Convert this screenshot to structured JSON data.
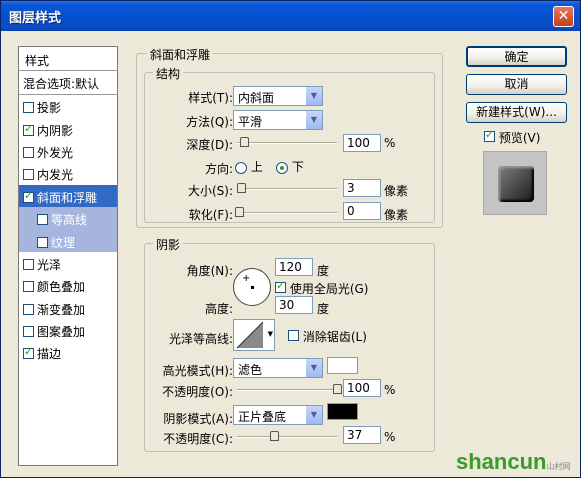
{
  "window": {
    "title": "图层样式"
  },
  "sidebar": {
    "header": "样式",
    "blend": "混合选项:默认",
    "items": [
      {
        "label": "投影",
        "checked": false
      },
      {
        "label": "内阴影",
        "checked": true
      },
      {
        "label": "外发光",
        "checked": false
      },
      {
        "label": "内发光",
        "checked": false
      },
      {
        "label": "斜面和浮雕",
        "checked": true
      },
      {
        "label": "等高线",
        "checked": false
      },
      {
        "label": "纹理",
        "checked": false
      },
      {
        "label": "光泽",
        "checked": false
      },
      {
        "label": "颜色叠加",
        "checked": false
      },
      {
        "label": "渐变叠加",
        "checked": false
      },
      {
        "label": "图案叠加",
        "checked": false
      },
      {
        "label": "描边",
        "checked": true
      }
    ]
  },
  "bevel": {
    "section": "斜面和浮雕",
    "structure": "结构",
    "style_label": "样式(T):",
    "style_value": "内斜面",
    "method_label": "方法(Q):",
    "method_value": "平滑",
    "depth_label": "深度(D):",
    "depth_value": "100",
    "depth_unit": "%",
    "direction_label": "方向:",
    "dir_up": "上",
    "dir_down": "下",
    "size_label": "大小(S):",
    "size_value": "3",
    "size_unit": "像素",
    "soften_label": "软化(F):",
    "soften_value": "0",
    "soften_unit": "像素"
  },
  "shading": {
    "section": "阴影",
    "angle_label": "角度(N):",
    "angle_value": "120",
    "angle_unit": "度",
    "global_light": "使用全局光(G)",
    "altitude_label": "高度:",
    "altitude_value": "30",
    "altitude_unit": "度",
    "gloss_label": "光泽等高线:",
    "antialias": "消除锯齿(L)",
    "highlight_label": "高光模式(H):",
    "highlight_value": "滤色",
    "hl_opacity_label": "不透明度(O):",
    "hl_opacity_value": "100",
    "hl_opacity_unit": "%",
    "shadow_label": "阴影模式(A):",
    "shadow_value": "正片叠底",
    "sh_opacity_label": "不透明度(C):",
    "sh_opacity_value": "37",
    "sh_opacity_unit": "%"
  },
  "buttons": {
    "ok": "确定",
    "cancel": "取消",
    "new_style": "新建样式(W)...",
    "preview": "预览(V)"
  },
  "watermark": {
    "text": "shancun",
    "sub": "山村网"
  },
  "colors": {
    "highlight": "#ffffff",
    "shadow": "#000000",
    "selected": "#316ac5"
  }
}
